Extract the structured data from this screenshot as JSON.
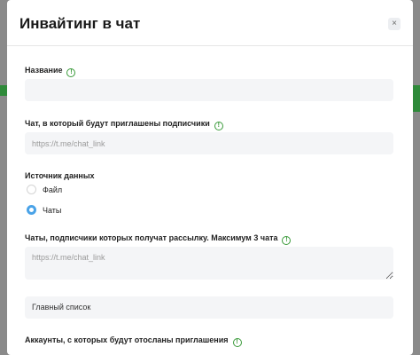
{
  "modal": {
    "title": "Инвайтинг в чат",
    "close_icon": "×"
  },
  "fields": {
    "name": {
      "label": "Название",
      "value": ""
    },
    "chat_link": {
      "label": "Чат, в который будут приглашены подписчики",
      "placeholder": "https://t.me/chat_link"
    },
    "data_source": {
      "label": "Источник данных",
      "options": [
        {
          "label": "Файл",
          "selected": false
        },
        {
          "label": "Чаты",
          "selected": true
        }
      ]
    },
    "source_chats": {
      "label": "Чаты, подписчики которых получат рассылку. Максимум 3 чата",
      "placeholder": "https://t.me/chat_link"
    },
    "list": {
      "value": "Главный список"
    },
    "accounts": {
      "label": "Аккаунты, с которых будут отосланы приглашения"
    }
  },
  "icons": {
    "info": "!"
  },
  "colors": {
    "info_green": "#3a9a3a",
    "radio_accent": "#4aa3e8",
    "field_bg": "#f4f5f7"
  }
}
